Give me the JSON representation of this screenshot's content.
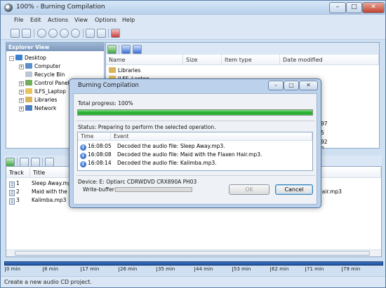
{
  "window": {
    "title": "100% - Burning Compilation",
    "controls": {
      "minimize": "–",
      "maximize": "□",
      "close": "✕"
    }
  },
  "menu": [
    "File",
    "Edit",
    "Actions",
    "View",
    "Options",
    "Help"
  ],
  "explorer": {
    "header": "Explorer View",
    "tree": [
      {
        "label": "Desktop",
        "icon": "desktop-icon",
        "expander": "–"
      },
      {
        "label": "Computer",
        "icon": "computer-icon",
        "expander": "+"
      },
      {
        "label": "Recycle Bin",
        "icon": "recycle-bin-icon",
        "expander": ""
      },
      {
        "label": "Control Panel",
        "icon": "control-panel-icon",
        "expander": "+"
      },
      {
        "label": "ILFS_Laptop",
        "icon": "folder-icon",
        "expander": "+"
      },
      {
        "label": "Libraries",
        "icon": "libraries-icon",
        "expander": "+"
      },
      {
        "label": "Network",
        "icon": "network-icon",
        "expander": "+"
      }
    ]
  },
  "files": {
    "columns": [
      "Name",
      "Size",
      "Item type",
      "Date modified"
    ],
    "rows": [
      {
        "name": "Libraries"
      },
      {
        "name": "ILFS_Laptop"
      }
    ],
    "partial_dates": [
      "97",
      "5",
      "92",
      "2"
    ]
  },
  "tracks": {
    "columns": [
      "Track",
      "Title"
    ],
    "rows": [
      {
        "track": "1",
        "title": "Sleep Away.mp3"
      },
      {
        "track": "2",
        "title": "Maid with the Flaxen Hair.mp3"
      },
      {
        "track": "3",
        "title": "Kalimba.mp3"
      }
    ],
    "right_overflow": "Hair.mp3"
  },
  "capacity": {
    "ticks": [
      "0 min",
      "8 min",
      "17 min",
      "26 min",
      "35 min",
      "44 min",
      "53 min",
      "62 min",
      "71 min",
      "79 min"
    ]
  },
  "status": "Create a new audio CD project.",
  "dialog": {
    "title": "Burning Compilation",
    "total_progress_label": "Total progress: 100%",
    "total_progress_value": 100,
    "status_text": "Status: Preparing to perform the selected operation.",
    "log_columns": [
      "Time",
      "Event"
    ],
    "log": [
      {
        "time": "16:08:05",
        "event": "Decoded the audio file: Sleep Away.mp3."
      },
      {
        "time": "16:08:08",
        "event": "Decoded the audio file: Maid with the Flaxen Hair.mp3."
      },
      {
        "time": "16:08:14",
        "event": "Decoded the audio file: Kalimba.mp3."
      }
    ],
    "device": "Device: E: Optiarc CDRWDVD CRX890A PH03",
    "write_buffer_label": "Write-buffer:",
    "ok": "OK",
    "cancel": "Cancel"
  },
  "colors": {
    "progress": "#1fa62a",
    "capacity": "#2a62b3",
    "title_bg": "#c7dbf2"
  }
}
